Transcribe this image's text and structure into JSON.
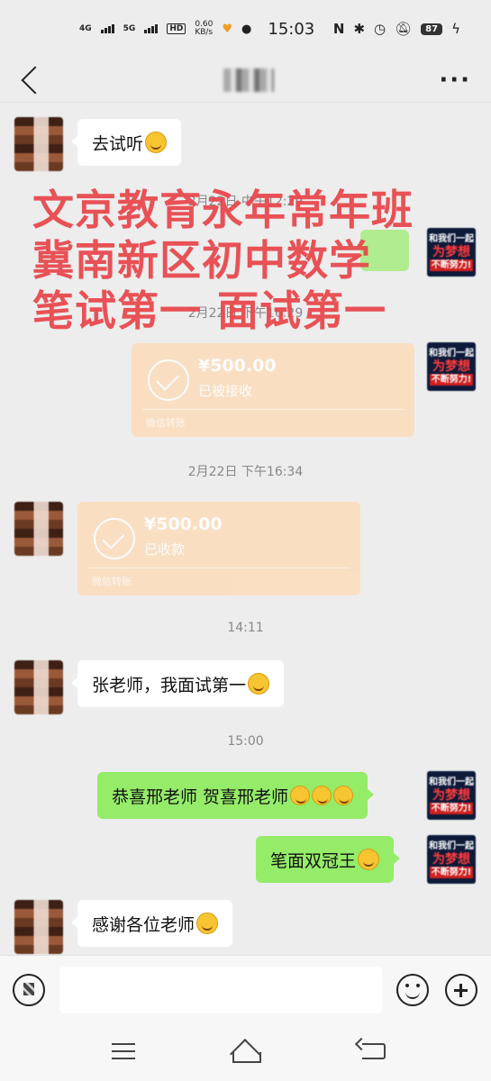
{
  "status_bar": {
    "network_1": "4G",
    "network_2": "5G",
    "hd": "HD",
    "speed": "0.60\nKB/s",
    "time": "15:03",
    "battery": "87"
  },
  "chat": {
    "messages": [
      {
        "text": "去试听"
      },
      {
        "time": "2月22日 中午12:29"
      },
      {
        "time": "2月22日 下午16:29"
      },
      {
        "amount": "¥500.00",
        "status": "已被接收",
        "footer": "微信转账"
      },
      {
        "time": "2月22日 下午16:34"
      },
      {
        "amount": "¥500.00",
        "status": "已收款",
        "footer": "微信转账"
      },
      {
        "time": "14:11"
      },
      {
        "text": "张老师，我面试第一"
      },
      {
        "time": "15:00"
      },
      {
        "text": "恭喜邢老师 贺喜邢老师"
      },
      {
        "text": "笔面双冠王"
      },
      {
        "text": "感谢各位老师"
      }
    ],
    "my_avatar": {
      "line1": "和我们一起",
      "line2": "为梦想",
      "line3": "不断努力!"
    }
  },
  "overlay": {
    "line1": "文京教育永年常年班",
    "line2": "冀南新区初中数学",
    "line3": "笔试第一 面试第一"
  },
  "colors": {
    "background": "#ededed",
    "outgoing_bubble": "#95ec69",
    "transfer_card": "#fcdcbb",
    "overlay_text": "#e8464a"
  }
}
